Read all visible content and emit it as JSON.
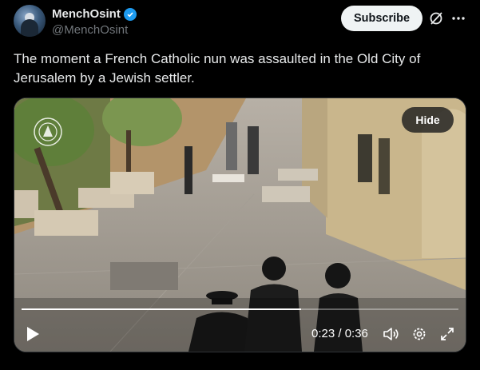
{
  "author": {
    "display_name": "MenchOsint",
    "handle": "@MenchOsint",
    "verified": true
  },
  "actions": {
    "subscribe_label": "Subscribe"
  },
  "tweet": {
    "text": "The moment a French Catholic nun was assaulted in the Old City of Jerusalem by a Jewish settler."
  },
  "video": {
    "hide_label": "Hide",
    "time_display": "0:23 / 0:36",
    "progress_fraction": 0.64
  },
  "icons": {
    "verified": "verified-badge-icon",
    "grok": "grok-icon",
    "more": "more-icon",
    "play": "play-icon",
    "volume": "volume-icon",
    "settings": "settings-icon",
    "fullscreen": "fullscreen-icon"
  },
  "colors": {
    "background": "#000000",
    "verified_blue": "#1d9bf0",
    "subscribe_bg": "#eff3f4"
  }
}
